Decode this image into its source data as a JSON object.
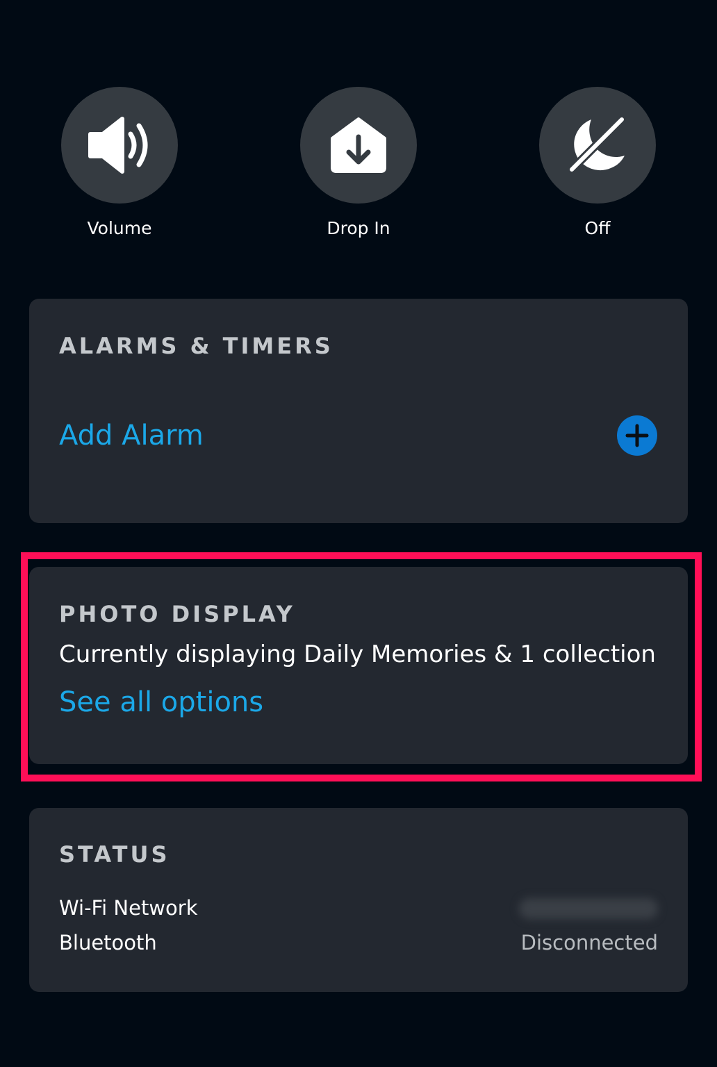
{
  "quick_actions": [
    {
      "label": "Volume",
      "icon": "speaker-volume-icon"
    },
    {
      "label": "Drop In",
      "icon": "drop-in-home-arrow-icon"
    },
    {
      "label": "Off",
      "icon": "do-not-disturb-off-icon"
    }
  ],
  "alarms": {
    "heading": "ALARMS & TIMERS",
    "add_alarm_label": "Add Alarm",
    "add_icon": "plus-circle-icon"
  },
  "photo_display": {
    "heading": "PHOTO DISPLAY",
    "description": "Currently displaying Daily Memories & 1 collection",
    "see_all_label": "See all options"
  },
  "status": {
    "heading": "STATUS",
    "rows": [
      {
        "label": "Wi-Fi Network",
        "value": ""
      },
      {
        "label": "Bluetooth",
        "value": "Disconnected"
      }
    ]
  },
  "colors": {
    "background": "#010a14",
    "card": "#232830",
    "action_circle": "#353b41",
    "link": "#1ba8e8",
    "add_button": "#0b7ad3",
    "highlight": "#ff0f57"
  }
}
